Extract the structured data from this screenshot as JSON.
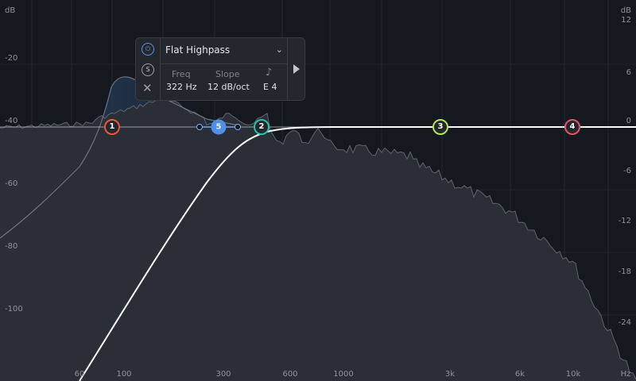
{
  "axis": {
    "left_unit": "dB",
    "left_ticks": [
      "-20",
      "-40",
      "-60",
      "-80",
      "-100"
    ],
    "right_unit": "dB",
    "right_ticks": [
      "12",
      "6",
      "0",
      "-6",
      "-12",
      "-18",
      "-24"
    ],
    "freq_unit": "Hz",
    "freq_ticks": [
      "60",
      "100",
      "300",
      "600",
      "1000",
      "3k",
      "6k",
      "10k"
    ]
  },
  "bands": [
    {
      "id": "1",
      "label": "1",
      "color": "#e8593b"
    },
    {
      "id": "2",
      "label": "2",
      "color": "#2bbfa6"
    },
    {
      "id": "3",
      "label": "3",
      "color": "#b7e05a"
    },
    {
      "id": "4",
      "label": "4",
      "color": "#e35467"
    },
    {
      "id": "5",
      "label": "5",
      "color": "#4f8fe8"
    }
  ],
  "selected_band": {
    "filter_type": "Flat Highpass",
    "freq_label": "Freq",
    "freq_value": "322 Hz",
    "slope_label": "Slope",
    "slope_value": "12 dB/oct",
    "note_icon": "music-note-icon",
    "note_value": "E 4"
  },
  "colors": {
    "background": "#15191f",
    "spectrum_fill": "#2a2e37",
    "curve": "#ffffff",
    "accent": "#4f8fe8"
  }
}
